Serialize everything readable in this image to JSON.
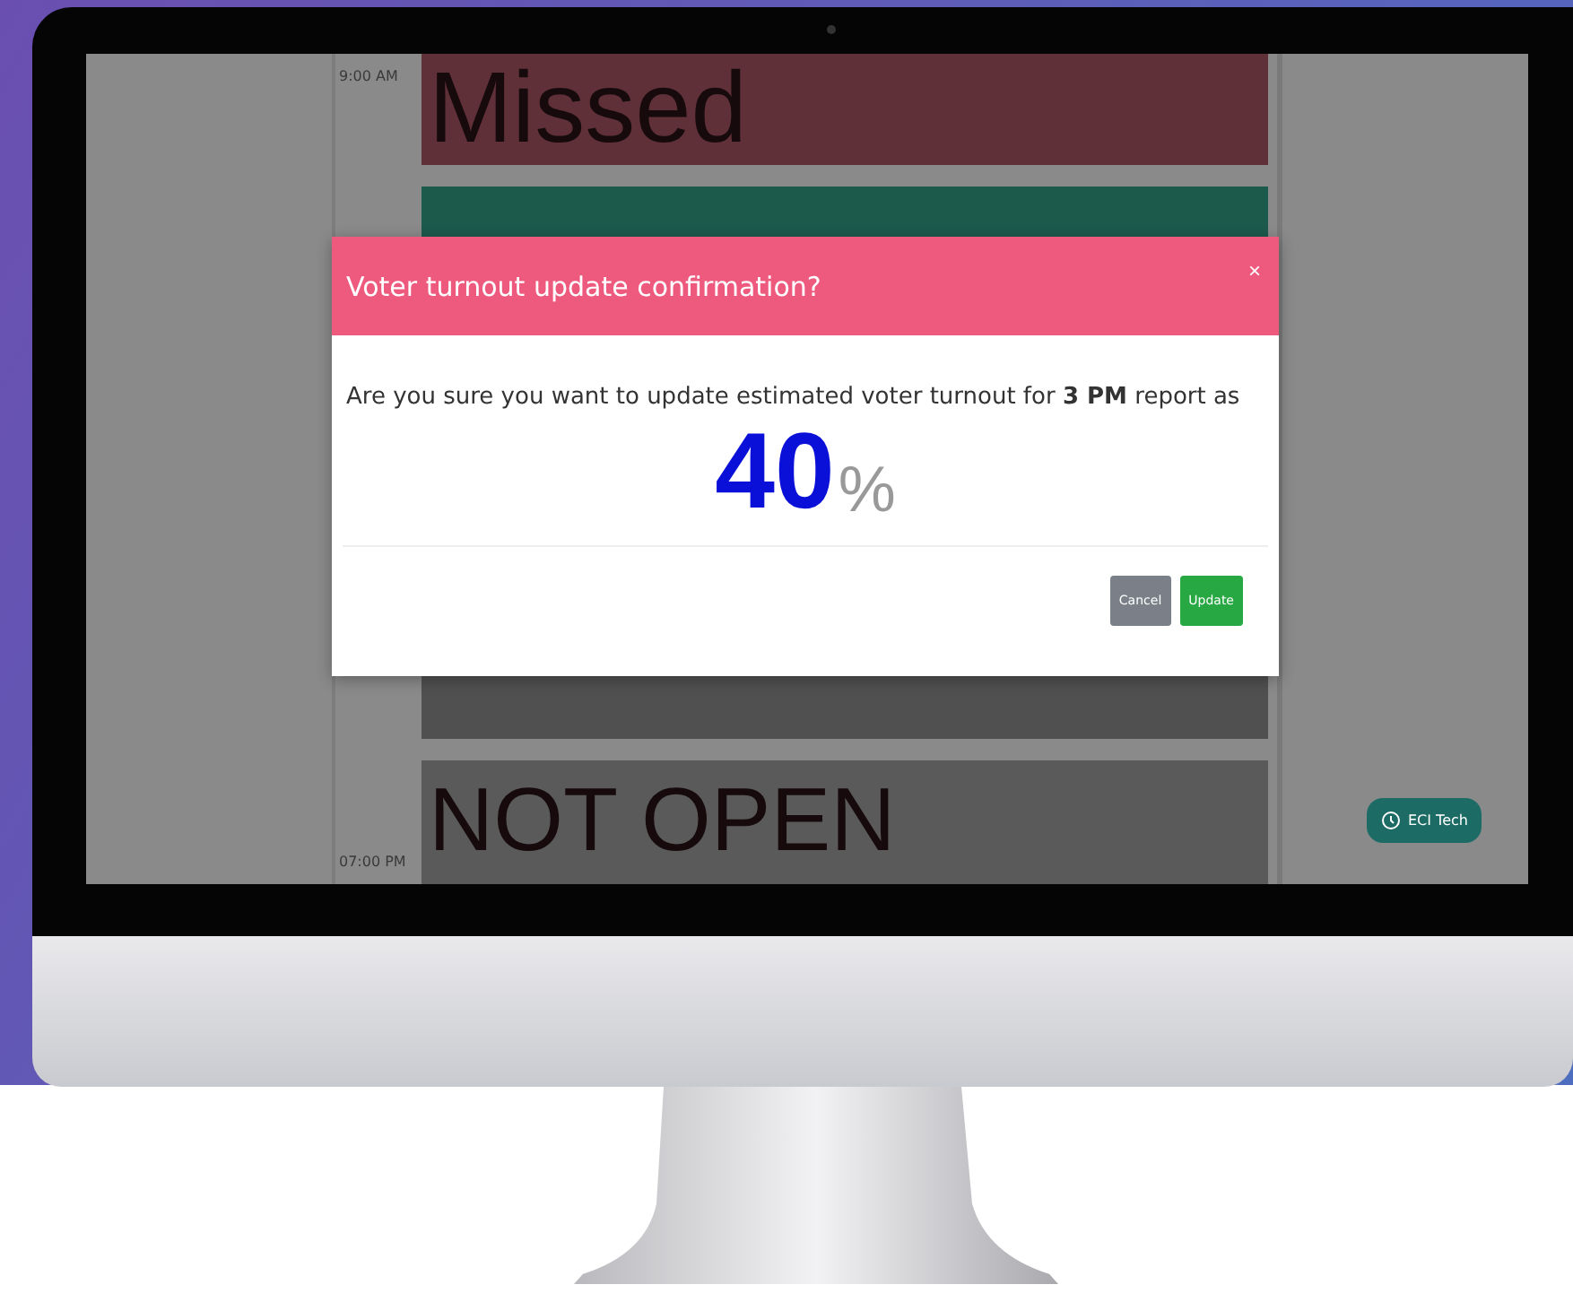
{
  "schedule": {
    "rows": [
      {
        "kind": "missed",
        "time": "9:00 AM",
        "status": "Missed"
      },
      {
        "kind": "reported"
      },
      {
        "kind": "pending"
      },
      {
        "kind": "not_open",
        "time": "07:00 PM",
        "status": "NOT OPEN"
      }
    ]
  },
  "dialog": {
    "title": "Voter turnout update confirmation?",
    "close": "×",
    "message": "Are you sure you want to update estimated voter turnout for **3 PM** report as",
    "value": "40",
    "unit": "%",
    "buttons": [
      {
        "label": "Cancel",
        "kind": "secondary"
      },
      {
        "label": "Update",
        "kind": "primary"
      }
    ]
  },
  "badge": {
    "label": "ECI Tech"
  }
}
